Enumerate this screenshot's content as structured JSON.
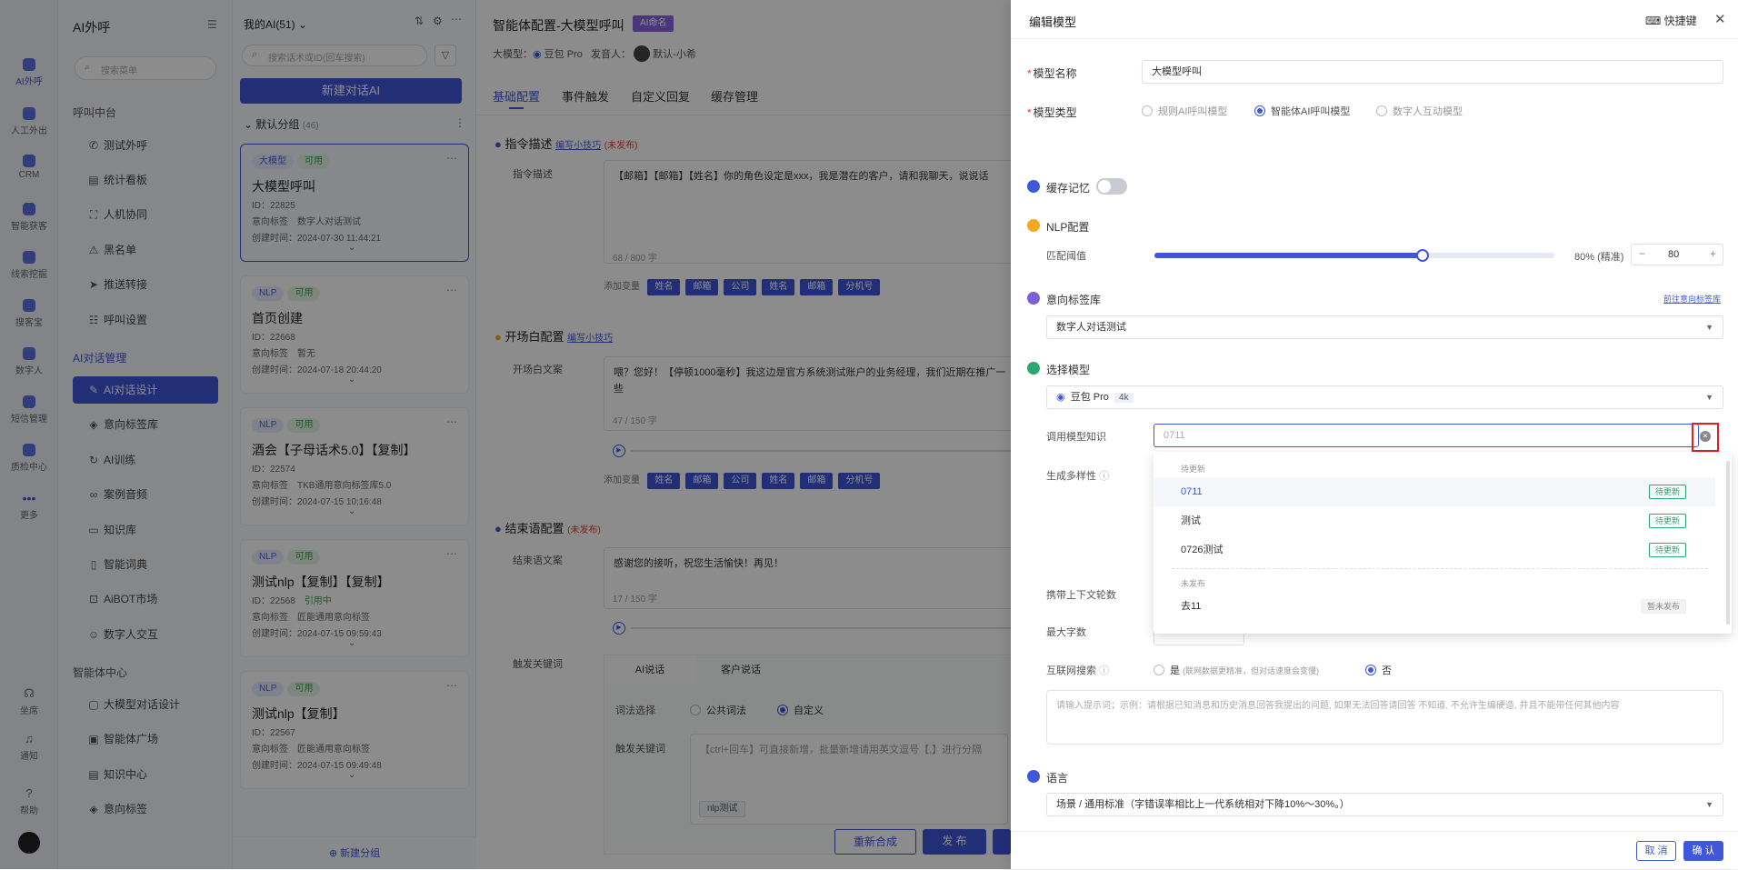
{
  "rail": {
    "items": [
      "AI外呼",
      "人工外出",
      "CRM",
      "智能获客",
      "线索挖掘",
      "搜客宝",
      "数字人",
      "短信管理",
      "质检中心",
      "更多",
      "坐席",
      "通知",
      "帮助"
    ]
  },
  "menu": {
    "title": "AI外呼",
    "search_placeholder": "搜索菜单",
    "sec1": "呼叫中台",
    "items1": [
      "测试外呼",
      "统计看板",
      "人机协同",
      "黑名单",
      "推送转接",
      "呼叫设置"
    ],
    "sec2": "AI对话管理",
    "items2": [
      "AI对话设计",
      "意向标签库",
      "AI训练",
      "案例音频",
      "知识库",
      "智能词典",
      "AiBOT市场",
      "数字人交互"
    ],
    "sec3": "智能体中心",
    "items3": [
      "大模型对话设计",
      "智能体广场",
      "知识中心",
      "意向标签"
    ]
  },
  "list": {
    "header": "我的AI(51)",
    "search_placeholder": "搜索话术或ID(回车搜索)",
    "new_btn": "新建对话AI",
    "group": "默认分组",
    "group_count": "(46)",
    "add_group": "新建分组",
    "cards": [
      {
        "tags": [
          "大模型",
          "可用"
        ],
        "title": "大模型呼叫",
        "id": "ID：22825",
        "intent": "意向标签　数字人对话测试",
        "created": "创建时间：2024-07-30 11:44:21"
      },
      {
        "tags": [
          "NLP",
          "可用"
        ],
        "title": "首页创建",
        "id": "ID：22668",
        "intent": "意向标签　暂无",
        "created": "创建时间：2024-07-18 20:44:20"
      },
      {
        "tags": [
          "NLP",
          "可用"
        ],
        "title": "酒会【子母话术5.0】【复制】",
        "id": "ID：22574",
        "intent": "意向标签　TKB通用意向标签库5.0",
        "created": "创建时间：2024-07-15 10:16:48"
      },
      {
        "tags": [
          "NLP",
          "可用"
        ],
        "title": "测试nlp【复制】【复制】",
        "id": "ID：22568",
        "ref": "引用中",
        "intent": "意向标签　匠能通用意向标签",
        "created": "创建时间：2024-07-15 09:59:43"
      },
      {
        "tags": [
          "NLP",
          "可用"
        ],
        "title": "测试nlp【复制】",
        "id": "ID：22567",
        "intent": "意向标签　匠能通用意向标签",
        "created": "创建时间：2024-07-15 09:49:48"
      }
    ]
  },
  "main": {
    "title": "智能体配置-大模型呼叫",
    "title_badge": "AI命名",
    "model_label": "大模型：",
    "model": "豆包 Pro",
    "speaker_label": "发音人：",
    "speaker": "默认-小希",
    "tabs": [
      "基础配置",
      "事件触发",
      "自定义回复",
      "缓存管理"
    ],
    "s1": {
      "title": "指令描述",
      "link": "编写小技巧",
      "status": "(未发布)",
      "field": "指令描述",
      "text": "【邮箱】【邮箱】【姓名】你的角色设定是xxx，我是潜在的客户，请和我聊天，说说话",
      "count": "68 / 800 字",
      "vars_label": "添加变量",
      "vars": [
        "姓名",
        "邮箱",
        "公司",
        "姓名",
        "邮箱",
        "分机号"
      ]
    },
    "s2": {
      "title": "开场白配置",
      "link": "编写小技巧",
      "field": "开场白文案",
      "text": "喂？您好！【停顿1000毫秒】我这边是官方系统测试账户的业务经理，我们近期在推广一些",
      "count": "47 / 150 字",
      "vars_label": "添加变量",
      "vars": [
        "姓名",
        "邮箱",
        "公司",
        "姓名",
        "邮箱",
        "分机号"
      ]
    },
    "s3": {
      "title": "结束语配置",
      "status": "(未发布)",
      "field": "结束语文案",
      "text": "感谢您的接听，祝您生活愉快！再见！",
      "count": "17 / 150 字"
    },
    "trigger": {
      "label": "触发关键词",
      "tabs": [
        "AI说话",
        "客户说话"
      ],
      "lib_label": "词法选择",
      "opt1": "公共词法",
      "opt2": "自定义",
      "kw_label": "触发关键词",
      "kw_placeholder": "【ctrl+回车】可直接新增，批量新增请用英文逗号【,】进行分隔",
      "kw_tag": "nlp测试"
    },
    "footer": {
      "resynth": "重新合成",
      "publish": "发 布"
    }
  },
  "drawer": {
    "title": "编辑模型",
    "shortcut": "快捷键",
    "name_label": "模型名称",
    "name_value": "大模型呼叫",
    "type_label": "模型类型",
    "types": [
      "规则AI呼叫模型",
      "智能体AI呼叫模型",
      "数字人互动模型"
    ],
    "cache_label": "缓存记忆",
    "nlp_label": "NLP配置",
    "match_label": "匹配阈值",
    "match_value": "80% (精准)",
    "stepper": "80",
    "match_fraction": 0.67,
    "intent_label": "意向标签库",
    "intent_link": "前往意向标签库",
    "intent_value": "数字人对话测试",
    "model_label": "选择模型",
    "model_value": "豆包 Pro",
    "model_badge": "4k",
    "knowledge_label": "调用模型知识",
    "knowledge_value": "0711",
    "diversity_label": "生成多样性",
    "context_label": "携带上下文轮数",
    "maxlen_label": "最大字数",
    "web_label": "互联网搜索",
    "web_yes": "是",
    "web_yes_note": "(联网数据更精准，但对话速度会变慢)",
    "web_no": "否",
    "prompt_placeholder": "请输入提示词；示例：请根据已知消息和历史消息回答我提出的问题, 如果无法回答请回答 不知道, 不允许生编硬造, 并且不能带任何其他内容",
    "lang_label": "语言",
    "lang_value": "场景 / 通用标准（字错误率相比上一代系统相对下降10%～30%。）",
    "cancel": "取 消",
    "confirm": "确 认",
    "dropdown": {
      "group1": "待更新",
      "items1": [
        {
          "name": "0711",
          "badge": "待更新"
        },
        {
          "name": "测试",
          "badge": "待更新"
        },
        {
          "name": "0726测试",
          "badge": "待更新"
        }
      ],
      "group2": "未发布",
      "items2": [
        {
          "name": "去11",
          "badge": "暂未发布"
        }
      ]
    },
    "colors": {
      "primary": "#3f57d9",
      "highlight": "#e02020",
      "green": "#2aa772"
    }
  }
}
